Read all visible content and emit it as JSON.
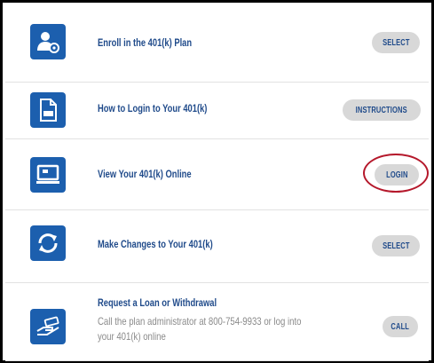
{
  "items": [
    {
      "title": "Enroll in the 401(k) Plan",
      "button": "SELECT",
      "icon": "user-gear-icon"
    },
    {
      "title": "How to Login to Your 401(k)",
      "button": "INSTRUCTIONS",
      "icon": "pdf-document-icon"
    },
    {
      "title": "View Your 401(k) Online",
      "button": "LOGIN",
      "icon": "monitor-icon"
    },
    {
      "title": "Make Changes to Your 401(k)",
      "button": "SELECT",
      "icon": "refresh-icon"
    },
    {
      "title": "Request a Loan or Withdrawal",
      "description": "Call the plan administrator at 800-754-9933 or log into your 401(k) online",
      "button": "CALL",
      "icon": "hand-money-icon"
    }
  ],
  "colors": {
    "accent": "#1c5fae",
    "title": "#1f4a8a",
    "button_bg": "#d8d8d8",
    "highlight": "#b5182b"
  }
}
